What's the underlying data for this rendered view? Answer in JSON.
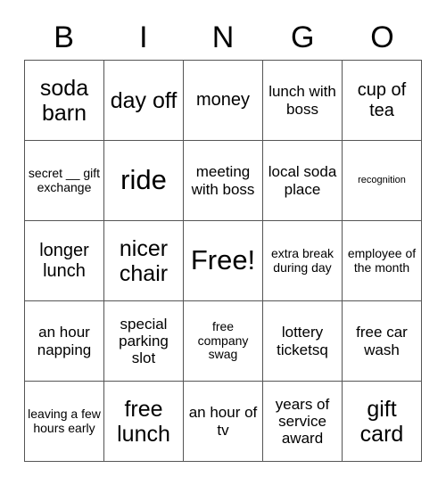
{
  "header": {
    "letters": [
      "B",
      "I",
      "N",
      "G",
      "O"
    ]
  },
  "grid": {
    "rows": [
      [
        {
          "text": "soda barn",
          "size": "xl"
        },
        {
          "text": "day off",
          "size": "xl"
        },
        {
          "text": "money",
          "size": "lg"
        },
        {
          "text": "lunch with boss",
          "size": "md"
        },
        {
          "text": "cup of tea",
          "size": "lg"
        }
      ],
      [
        {
          "text": "secret __ gift exchange",
          "size": "sm"
        },
        {
          "text": "ride",
          "size": "xxl"
        },
        {
          "text": "meeting with boss",
          "size": "md"
        },
        {
          "text": "local soda place",
          "size": "md"
        },
        {
          "text": "recognition",
          "size": "xs"
        }
      ],
      [
        {
          "text": "longer lunch",
          "size": "lg"
        },
        {
          "text": "nicer chair",
          "size": "xl"
        },
        {
          "text": "Free!",
          "size": "xxl"
        },
        {
          "text": "extra break during day",
          "size": "sm"
        },
        {
          "text": "employee of the month",
          "size": "sm"
        }
      ],
      [
        {
          "text": "an hour napping",
          "size": "md"
        },
        {
          "text": "special parking slot",
          "size": "md"
        },
        {
          "text": "free company swag",
          "size": "sm"
        },
        {
          "text": "lottery ticketsq",
          "size": "md"
        },
        {
          "text": "free car wash",
          "size": "md"
        }
      ],
      [
        {
          "text": "leaving a few hours early",
          "size": "sm"
        },
        {
          "text": "free lunch",
          "size": "xl"
        },
        {
          "text": "an hour of tv",
          "size": "md"
        },
        {
          "text": "years of service award",
          "size": "md"
        },
        {
          "text": "gift card",
          "size": "xl"
        }
      ]
    ]
  },
  "colors": {
    "background": "#ffffff",
    "text": "#000000",
    "grid_line": "#555555"
  }
}
